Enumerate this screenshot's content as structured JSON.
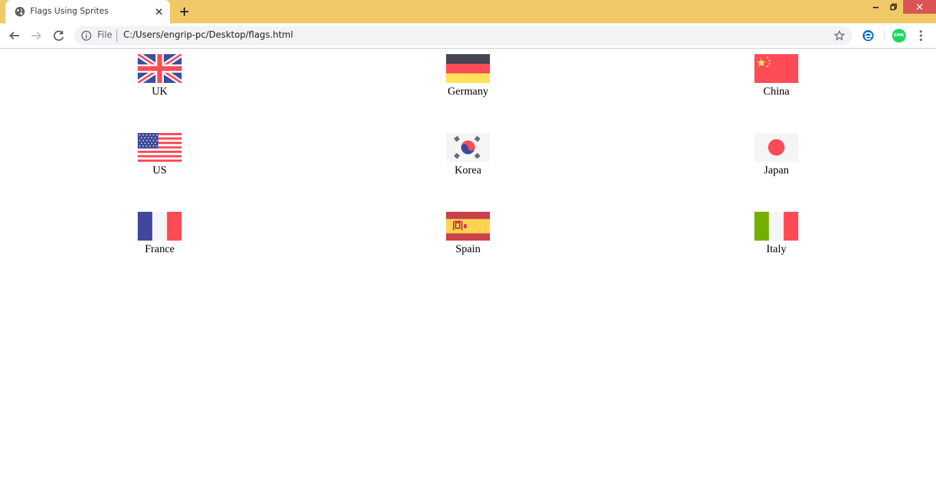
{
  "browser": {
    "tab_title": "Flags Using Sprites",
    "omnibox": {
      "scheme_label": "File",
      "url": "C:/Users/engrip-pc/Desktop/flags.html"
    },
    "avatar_initials": "SMK",
    "titlebar_color": "#f0c866",
    "close_button_color": "#d95453",
    "avatar_color": "#1ed760"
  },
  "flags": {
    "row1": [
      {
        "label": "UK",
        "icon": "uk-flag-icon"
      },
      {
        "label": "Germany",
        "icon": "germany-flag-icon"
      },
      {
        "label": "China",
        "icon": "china-flag-icon"
      }
    ],
    "row2": [
      {
        "label": "US",
        "icon": "us-flag-icon"
      },
      {
        "label": "Korea",
        "icon": "korea-flag-icon"
      },
      {
        "label": "Japan",
        "icon": "japan-flag-icon"
      }
    ],
    "row3": [
      {
        "label": "France",
        "icon": "france-flag-icon"
      },
      {
        "label": "Spain",
        "icon": "spain-flag-icon"
      },
      {
        "label": "Italy",
        "icon": "italy-flag-icon"
      }
    ]
  }
}
